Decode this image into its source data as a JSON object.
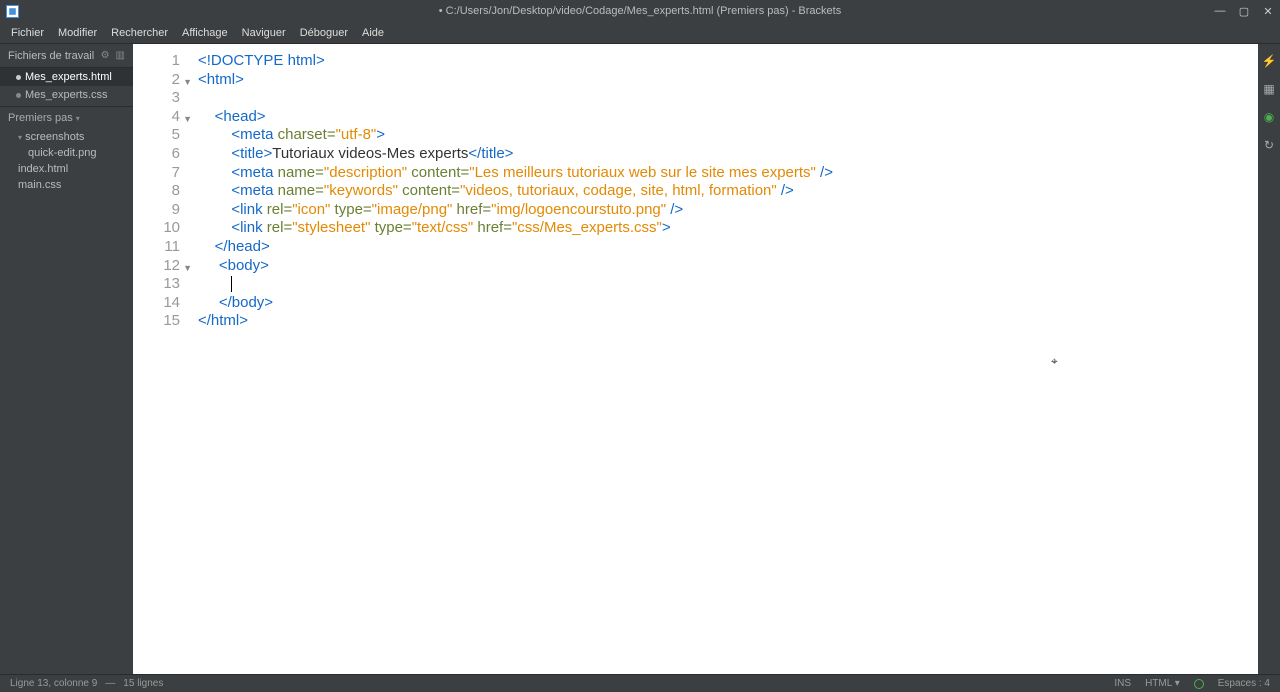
{
  "title": "• C:/Users/Jon/Desktop/video/Codage/Mes_experts.html (Premiers pas) - Brackets",
  "menu": [
    "Fichier",
    "Modifier",
    "Rechercher",
    "Affichage",
    "Naviguer",
    "Déboguer",
    "Aide"
  ],
  "sidebar": {
    "working_header": "Fichiers de travail",
    "working_files": [
      {
        "name": "Mes_experts.html",
        "active": true
      },
      {
        "name": "Mes_experts.css",
        "active": false
      }
    ],
    "project_header": "Premiers pas",
    "tree": {
      "folder": "screenshots",
      "files": [
        "quick-edit.png",
        "index.html",
        "main.css"
      ]
    }
  },
  "code": {
    "lines": [
      1,
      2,
      3,
      4,
      5,
      6,
      7,
      8,
      9,
      10,
      11,
      12,
      13,
      14,
      15
    ],
    "folds": [
      2,
      4,
      12
    ],
    "l1_a": "<!DOCTYPE html>",
    "l2_a": "<html>",
    "l4_a": "<head>",
    "l5_t1": "<meta ",
    "l5_a1": "charset=",
    "l5_s1": "\"utf-8\"",
    "l5_t2": ">",
    "l6_t1": "<title>",
    "l6_tx": "Tutoriaux videos-Mes experts",
    "l6_t2": "</title>",
    "l7_t1": "<meta ",
    "l7_a1": "name=",
    "l7_s1": "\"description\"",
    "l7_a2": " content=",
    "l7_s2": "\"Les meilleurs tutoriaux web sur le site mes experts\"",
    "l7_t2": " />",
    "l8_t1": "<meta ",
    "l8_a1": "name=",
    "l8_s1": "\"keywords\"",
    "l8_a2": " content=",
    "l8_s2": "\"videos, tutoriaux, codage, site, html, formation\"",
    "l8_t2": " />",
    "l9_t1": "<link ",
    "l9_a1": "rel=",
    "l9_s1": "\"icon\"",
    "l9_a2": " type=",
    "l9_s2": "\"image/png\"",
    "l9_a3": " href=",
    "l9_s3": "\"img/logoencourstuto.png\"",
    "l9_t2": " />",
    "l10_t1": "<link ",
    "l10_a1": "rel=",
    "l10_s1": "\"stylesheet\"",
    "l10_a2": " type=",
    "l10_s2": "\"text/css\"",
    "l10_a3": " href=",
    "l10_s3": "\"css/Mes_experts.css\"",
    "l10_t2": ">",
    "l11_a": "</head>",
    "l12_a": "<body>",
    "l14_a": "</body>",
    "l15_a": "</html>"
  },
  "status": {
    "pos": "Ligne 13, colonne 9",
    "sep": "—",
    "lines": "15 lignes",
    "ins": "INS",
    "lang": "HTML",
    "spaces": "Espaces : 4"
  }
}
